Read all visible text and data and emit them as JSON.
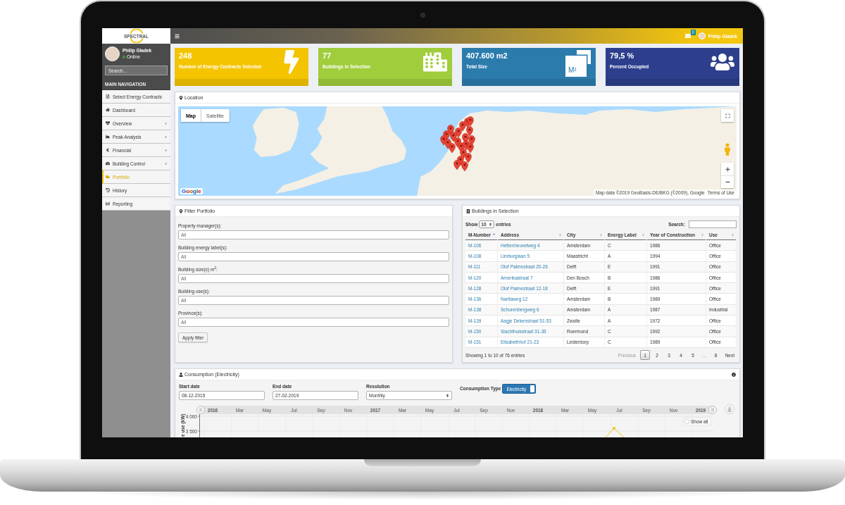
{
  "sidebar": {
    "logo": "SPECTRAL",
    "user": {
      "name": "Philip Gladek",
      "status": "Online",
      "online": true
    },
    "search": {
      "placeholder": "Search..."
    },
    "nav_header": "MAIN NAVIGATION",
    "items": [
      {
        "kind": "contracts",
        "label": "Select Energy Contracts",
        "expandable": false,
        "selected": false
      },
      {
        "kind": "dashboard",
        "label": "Dashboard",
        "expandable": false,
        "selected": false
      },
      {
        "kind": "overview",
        "label": "Overview",
        "expandable": true,
        "selected": false
      },
      {
        "kind": "peak",
        "label": "Peak Analysis",
        "expandable": true,
        "selected": false
      },
      {
        "kind": "financial",
        "label": "Financial",
        "expandable": true,
        "selected": false
      },
      {
        "kind": "control",
        "label": "Building Control",
        "expandable": true,
        "selected": false
      },
      {
        "kind": "portfolio",
        "label": "Portfolio",
        "expandable": false,
        "selected": true
      },
      {
        "kind": "history",
        "label": "History",
        "expandable": false,
        "selected": false
      },
      {
        "kind": "reporting",
        "label": "Reporting",
        "expandable": false,
        "selected": false
      }
    ]
  },
  "header": {
    "notification_count": "0",
    "user_name": "Philip Gladek"
  },
  "stats": [
    {
      "kind": "bolt",
      "value": "248",
      "label": "Number of Energy Contracts Selected",
      "color": "#f5c400"
    },
    {
      "kind": "buildings",
      "value": "77",
      "label": "Buildings in Selection",
      "color": "#9fcd3c"
    },
    {
      "kind": "area",
      "value": "407.600 m2",
      "label": "Total Size",
      "color": "#2b7bad",
      "icon_label": "M²"
    },
    {
      "kind": "people",
      "value": "79,5 %",
      "label": "Percent Occupied",
      "color": "#2c3e8c"
    }
  ],
  "location": {
    "title": "Location",
    "map_types": [
      {
        "label": "Map",
        "selected": true
      },
      {
        "label": "Satellite",
        "selected": false
      }
    ],
    "logo": "Google",
    "attribution": "Map data ©2019 GeoBasis-DE/BKG (©2009), Google",
    "terms": "Terms of Use"
  },
  "filter": {
    "title": "Filter Portfolio",
    "fields": [
      {
        "label": "Property manager(s):",
        "placeholder": "All"
      },
      {
        "label": "Building energy label(s):",
        "placeholder": "All"
      },
      {
        "label": "Building size(s) m$^{2}$:",
        "placeholder": "All"
      },
      {
        "label": "Building use(s):",
        "placeholder": "All"
      },
      {
        "label": "Province(s):",
        "placeholder": "All"
      }
    ],
    "button": "Apply filter"
  },
  "buildings": {
    "title": "Buildings in Selection",
    "show_label": "Show",
    "page_size": "10",
    "entries_label": "entries",
    "search_label": "Search:",
    "columns": [
      {
        "label": "M-Number",
        "kind": "link",
        "sorted": true
      },
      {
        "label": "Address",
        "kind": "link",
        "sorted": false
      },
      {
        "label": "City",
        "kind": "text",
        "sorted": false
      },
      {
        "label": "Energy Label",
        "kind": "text",
        "sorted": false
      },
      {
        "label": "Year of Construction",
        "kind": "text",
        "sorted": false
      },
      {
        "label": "Use",
        "kind": "text",
        "sorted": false
      }
    ],
    "rows": [
      [
        "M-106",
        "Hettenheuvelweg 4",
        "Amsterdam",
        "C",
        "1986",
        "Office"
      ],
      [
        "M-108",
        "Limburglaan 5",
        "Maastricht",
        "A",
        "1994",
        "Office"
      ],
      [
        "M-111",
        "Olof Palmestraat 20-26",
        "Delft",
        "E",
        "1991",
        "Office"
      ],
      [
        "M-120",
        "Amerikastraat 7",
        "Den Bosch",
        "B",
        "1986",
        "Office"
      ],
      [
        "M-128",
        "Olof Palmestraat 12-18",
        "Delft",
        "E",
        "1991",
        "Office"
      ],
      [
        "M-136",
        "Naritaweg 12",
        "Amsterdam",
        "B",
        "1989",
        "Office"
      ],
      [
        "M-138",
        "Schurenbergweg 6",
        "Amsterdam",
        "A",
        "1987",
        "Industrial"
      ],
      [
        "M-139",
        "Aagje Dekenstraat 51-53",
        "Zwolle",
        "A",
        "1972",
        "Office"
      ],
      [
        "M-150",
        "Slachthuisstraat 31-35",
        "Roermond",
        "C",
        "1992",
        "Office"
      ],
      [
        "M-151",
        "Elisabethhof 21-23",
        "Leiderdorp",
        "C",
        "1989",
        "Office"
      ]
    ],
    "info": "Showing 1 to 10 of 76 entries",
    "pagination": [
      {
        "label": "Previous",
        "kind": "nav",
        "selected": false,
        "disabled": true
      },
      {
        "label": "1",
        "kind": "page",
        "selected": true,
        "disabled": false
      },
      {
        "label": "2",
        "kind": "page",
        "selected": false,
        "disabled": false
      },
      {
        "label": "3",
        "kind": "page",
        "selected": false,
        "disabled": false
      },
      {
        "label": "4",
        "kind": "page",
        "selected": false,
        "disabled": false
      },
      {
        "label": "5",
        "kind": "page",
        "selected": false,
        "disabled": false
      },
      {
        "label": "…",
        "kind": "gap",
        "selected": false,
        "disabled": false
      },
      {
        "label": "8",
        "kind": "page",
        "selected": false,
        "disabled": false
      },
      {
        "label": "Next",
        "kind": "nav",
        "selected": false,
        "disabled": false
      }
    ]
  },
  "consumption": {
    "title": "Consumption (Electricity)",
    "fields": [
      {
        "kind": "input",
        "label": "Start date",
        "value": "08-12-2015"
      },
      {
        "kind": "input",
        "label": "End date",
        "value": "27-02-2019"
      },
      {
        "kind": "select",
        "label": "Resolution",
        "value": "Monthly"
      }
    ],
    "type_label": "Consumption Type",
    "type_toggle": {
      "label": "Electricity",
      "on": true
    },
    "chart": {
      "timeline": [
        {
          "label": "2016",
          "kind": "year"
        },
        {
          "label": "Mar",
          "kind": "month"
        },
        {
          "label": "May",
          "kind": "month"
        },
        {
          "label": "Jul",
          "kind": "month"
        },
        {
          "label": "Sep",
          "kind": "month"
        },
        {
          "label": "Nov",
          "kind": "month"
        },
        {
          "label": "2017",
          "kind": "year"
        },
        {
          "label": "Mar",
          "kind": "month"
        },
        {
          "label": "May",
          "kind": "month"
        },
        {
          "label": "Jul",
          "kind": "month"
        },
        {
          "label": "Sep",
          "kind": "month"
        },
        {
          "label": "Nov",
          "kind": "month"
        },
        {
          "label": "2018",
          "kind": "year"
        },
        {
          "label": "Mar",
          "kind": "month"
        },
        {
          "label": "May",
          "kind": "month"
        },
        {
          "label": "Jul",
          "kind": "month"
        },
        {
          "label": "Sep",
          "kind": "month"
        },
        {
          "label": "Nov",
          "kind": "month"
        },
        {
          "label": "2019",
          "kind": "year"
        }
      ],
      "y_title": "e use (kW)",
      "y_ticks": [
        "4 000",
        "3 500"
      ],
      "reset_button": "Show all"
    }
  }
}
